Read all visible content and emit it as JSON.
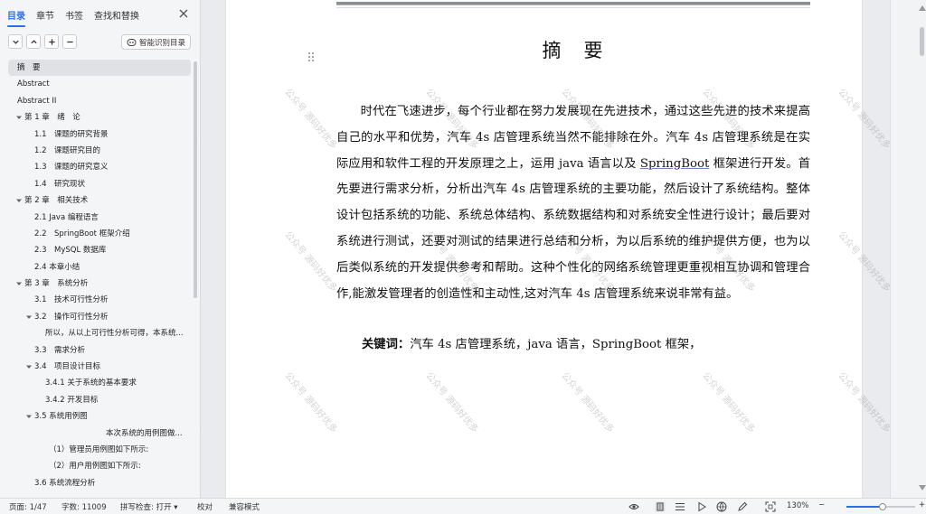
{
  "sidebar": {
    "tabs": [
      "目录",
      "章节",
      "书签",
      "查找和替换"
    ],
    "smart_button": "智能识别目录",
    "toc": [
      {
        "label": "摘　要",
        "indent": 0,
        "caret": "",
        "selected": true
      },
      {
        "label": "Abstract",
        "indent": 0,
        "caret": "",
        "selected": false
      },
      {
        "label": "Abstract II",
        "indent": 0,
        "caret": "",
        "selected": false
      },
      {
        "label": "第 1 章　绪　论",
        "indent": 1,
        "caret": "down",
        "selected": false
      },
      {
        "label": "1.1　课题的研究背景",
        "indent": 2,
        "caret": "",
        "selected": false
      },
      {
        "label": "1.2　课题研究目的",
        "indent": 2,
        "caret": "",
        "selected": false
      },
      {
        "label": "1.3　课题的研究意义",
        "indent": 2,
        "caret": "",
        "selected": false
      },
      {
        "label": "1.4　研究现状",
        "indent": 2,
        "caret": "",
        "selected": false
      },
      {
        "label": "第 2 章　相关技术",
        "indent": 1,
        "caret": "down",
        "selected": false
      },
      {
        "label": "2.1 Java 编程语言",
        "indent": 2,
        "caret": "",
        "selected": false
      },
      {
        "label": "2.2　SpringBoot 框架介绍",
        "indent": 2,
        "caret": "",
        "selected": false
      },
      {
        "label": "2.3　MySQL 数据库",
        "indent": 2,
        "caret": "",
        "selected": false
      },
      {
        "label": "2.4 本章小结",
        "indent": 2,
        "caret": "",
        "selected": false
      },
      {
        "label": "第 3 章　系统分析",
        "indent": 1,
        "caret": "down",
        "selected": false
      },
      {
        "label": "3.1　技术可行性分析",
        "indent": 2,
        "caret": "",
        "selected": false
      },
      {
        "label": "3.2　操作可行性分析",
        "indent": 3,
        "caret": "down",
        "selected": false
      },
      {
        "label": "所以，从以上可行性分析可得，本系统...",
        "indent": 4,
        "caret": "",
        "selected": false
      },
      {
        "label": "3.3　需求分析",
        "indent": 2,
        "caret": "",
        "selected": false
      },
      {
        "label": "3.4　项目设计目标",
        "indent": 3,
        "caret": "down",
        "selected": false
      },
      {
        "label": "3.4.1 关于系统的基本要求",
        "indent": 5,
        "caret": "",
        "selected": false
      },
      {
        "label": "3.4.2 开发目标",
        "indent": 5,
        "caret": "",
        "selected": false
      },
      {
        "label": "3.5 系统用例图",
        "indent": 3,
        "caret": "down",
        "selected": false
      },
      {
        "label": "本次系统的用例图做...",
        "indent": 6,
        "caret": "",
        "selected": false
      },
      {
        "label": "（1）管理员用例图如下所示:",
        "indent": 7,
        "caret": "",
        "selected": false
      },
      {
        "label": "（2）用户用例图如下所示:",
        "indent": 7,
        "caret": "",
        "selected": false
      },
      {
        "label": "3.6 系统流程分析",
        "indent": 2,
        "caret": "",
        "selected": false
      }
    ]
  },
  "document": {
    "title": "摘　要",
    "para_1": "时代在飞速进步，每个行业都在努力发展现在先进技术，通过这些先进的技术来提高自己的水平和优势，汽车 4s 店管理系统当然不能排除在外。汽车 4s 店管理系统是在实际应用和软件工程的开发原理之上，运用 java 语言以及 ",
    "springboot": "SpringBoot",
    "para_2": " 框架进行开发。首先要进行需求分析，分析出汽车 4s 店管理系统的主要功能，然后设计了系统结构。整体设计包括系统的功能、系统总体结构、系统数据结构和对系统安全性进行设计；最后要对系统进行测试，还要对测试的结果进行总结和分析，为以后系统的维护提供方便，也为以后类似系统的开发提供参考和帮助。这种个性化的网络系统管理更重视相互协调和管理合作,能激发管理者的创造性和主动性,这对汽车 4s 店管理系统来说非常有益。",
    "keywords_label": "关键词：",
    "keywords_value_1": "汽车 4s 店管理系统，java 语言，",
    "keywords_value_2": " 框架，",
    "watermark": "公众号 源码好优多"
  },
  "statusbar": {
    "page": "页面: 1/47",
    "words": "字数: 11009",
    "spellcheck": "拼写检查: 打开",
    "proofread": "校对",
    "compat": "兼容模式",
    "zoom": "130%",
    "zoom_level": 0.52
  },
  "colors": {
    "accent": "#2b6ee8"
  }
}
